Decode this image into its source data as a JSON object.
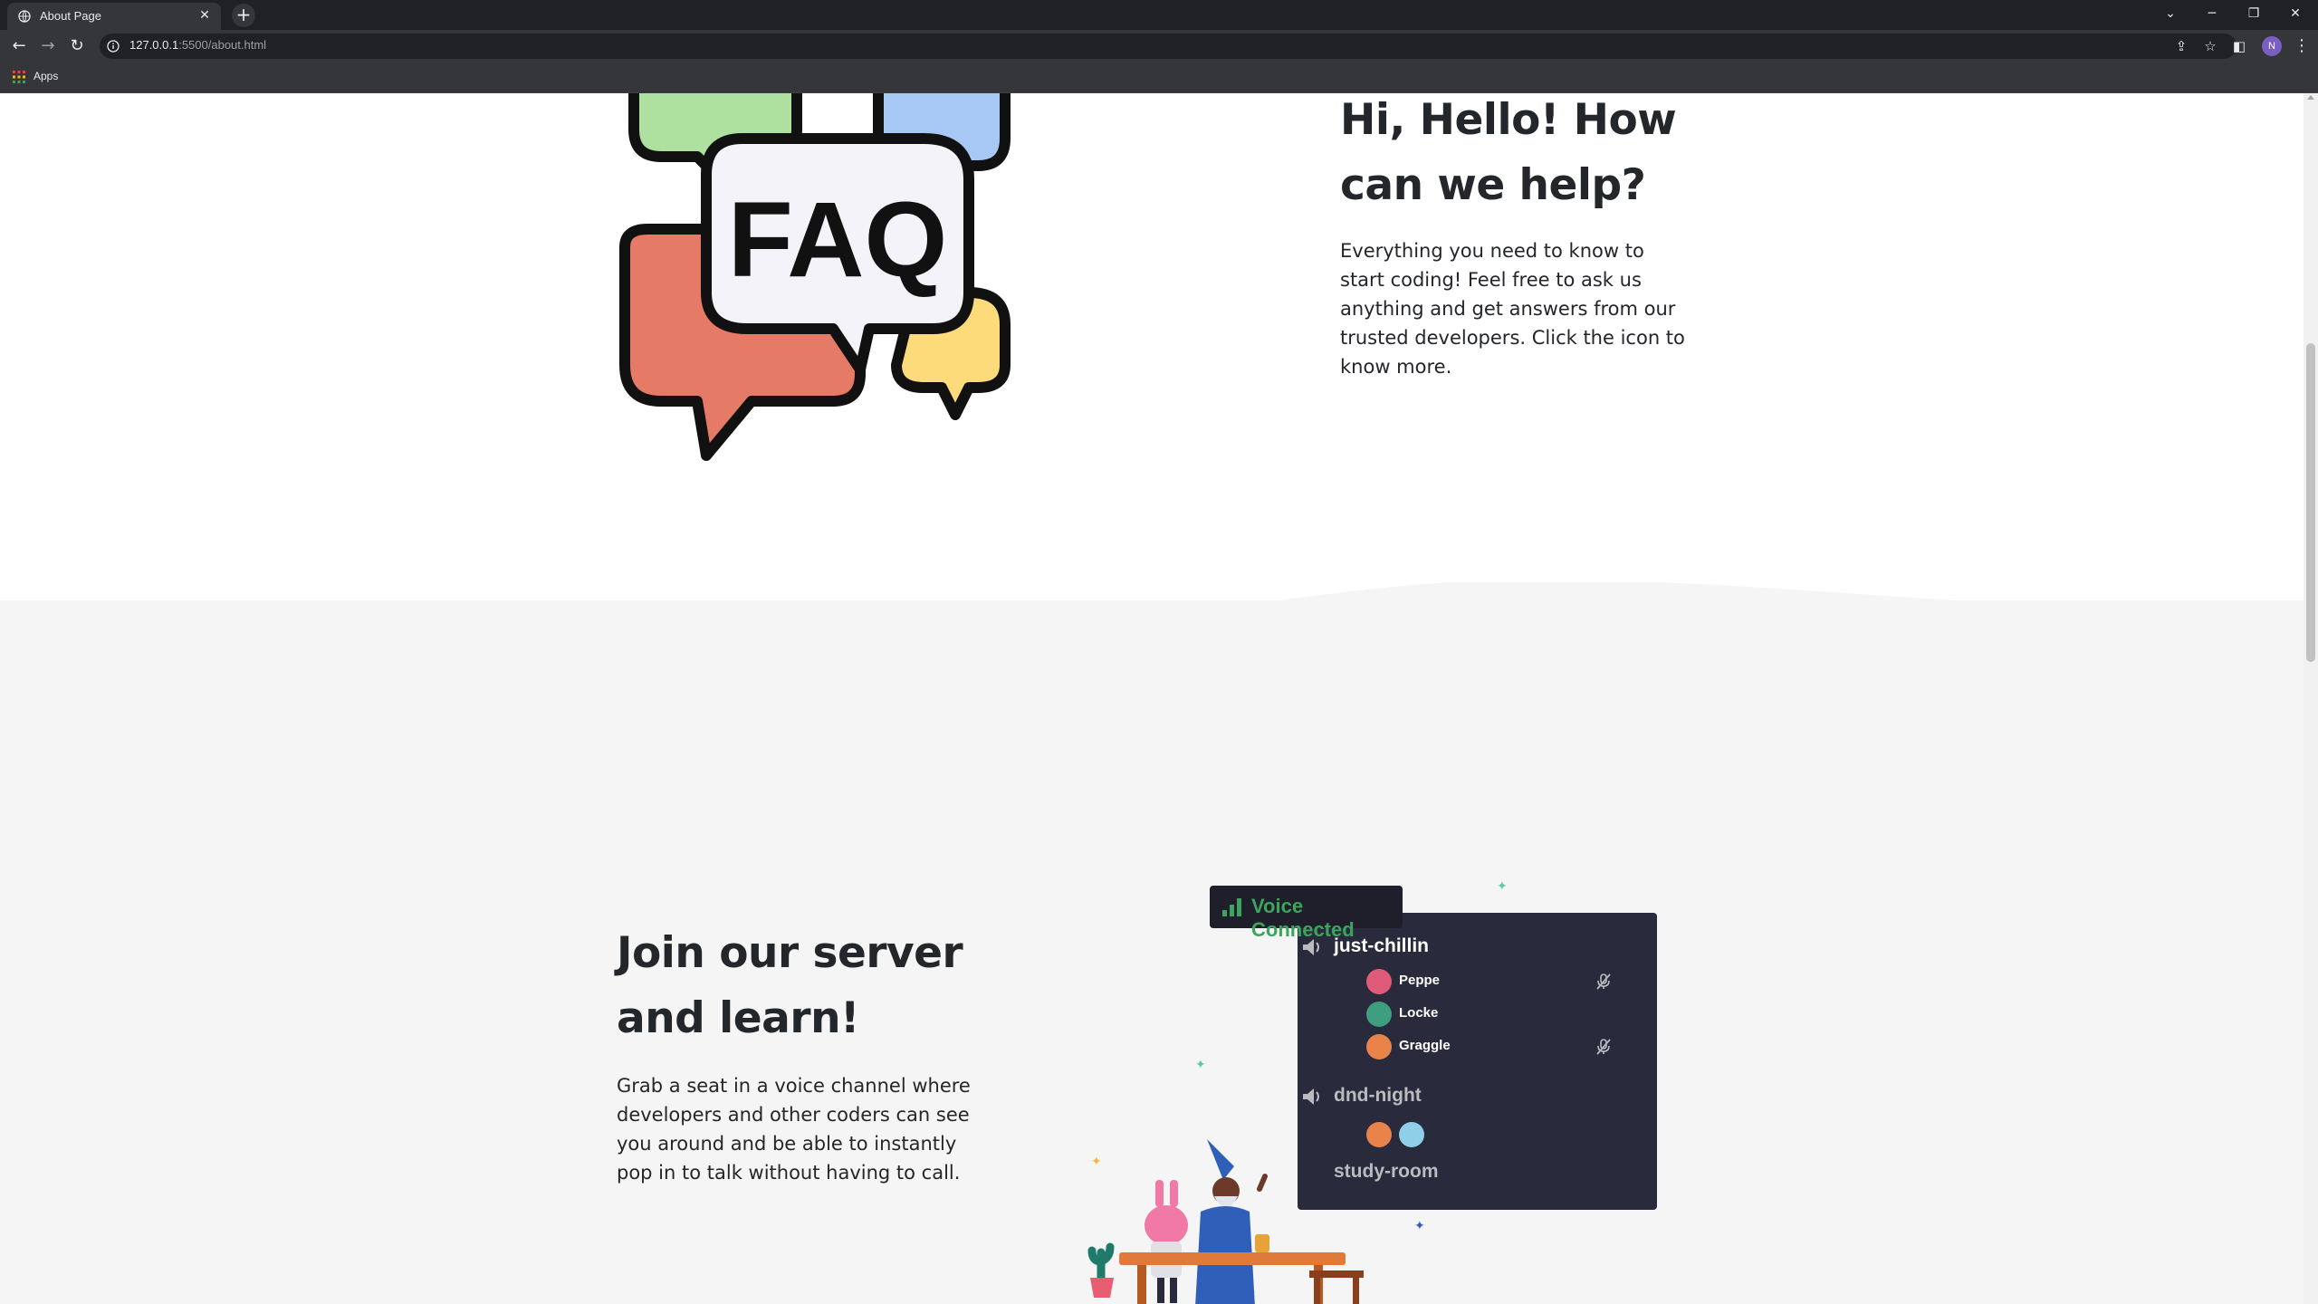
{
  "browser": {
    "tab_title": "About Page",
    "url_host": "127.0.0.1",
    "url_rest": ":5500/about.html",
    "bookmarks_label": "Apps",
    "profile_initial": "N"
  },
  "faq_section": {
    "art_text": "FAQ",
    "heading": "Hi, Hello! How can we help?",
    "paragraph": "Everything you need to know to start coding! Feel free to ask us anything and get answers from our trusted developers. Click the icon to know more."
  },
  "server_section": {
    "heading": "Join our server and learn!",
    "paragraph": "Grab a seat in a voice channel where developers and other coders can see you around and be able to instantly pop in to talk without having to call.",
    "voice_status": "Voice Connected",
    "channels": [
      {
        "name": "just-chillin",
        "members": [
          {
            "name": "Peppe",
            "muted": true,
            "color": "#e05a7a"
          },
          {
            "name": "Locke",
            "muted": false,
            "color": "#3e9e7e"
          },
          {
            "name": "Graggle",
            "muted": true,
            "color": "#e8834a"
          }
        ]
      },
      {
        "name": "dnd-night",
        "avatars": [
          "#e8834a",
          "#8fd0e8"
        ]
      },
      {
        "name": "study-room"
      }
    ]
  },
  "colors": {
    "voice_green": "#3ba55d",
    "panel_bg": "#2a2a3d",
    "text_dark": "#23262a",
    "section_gray": "#f5f5f5"
  }
}
